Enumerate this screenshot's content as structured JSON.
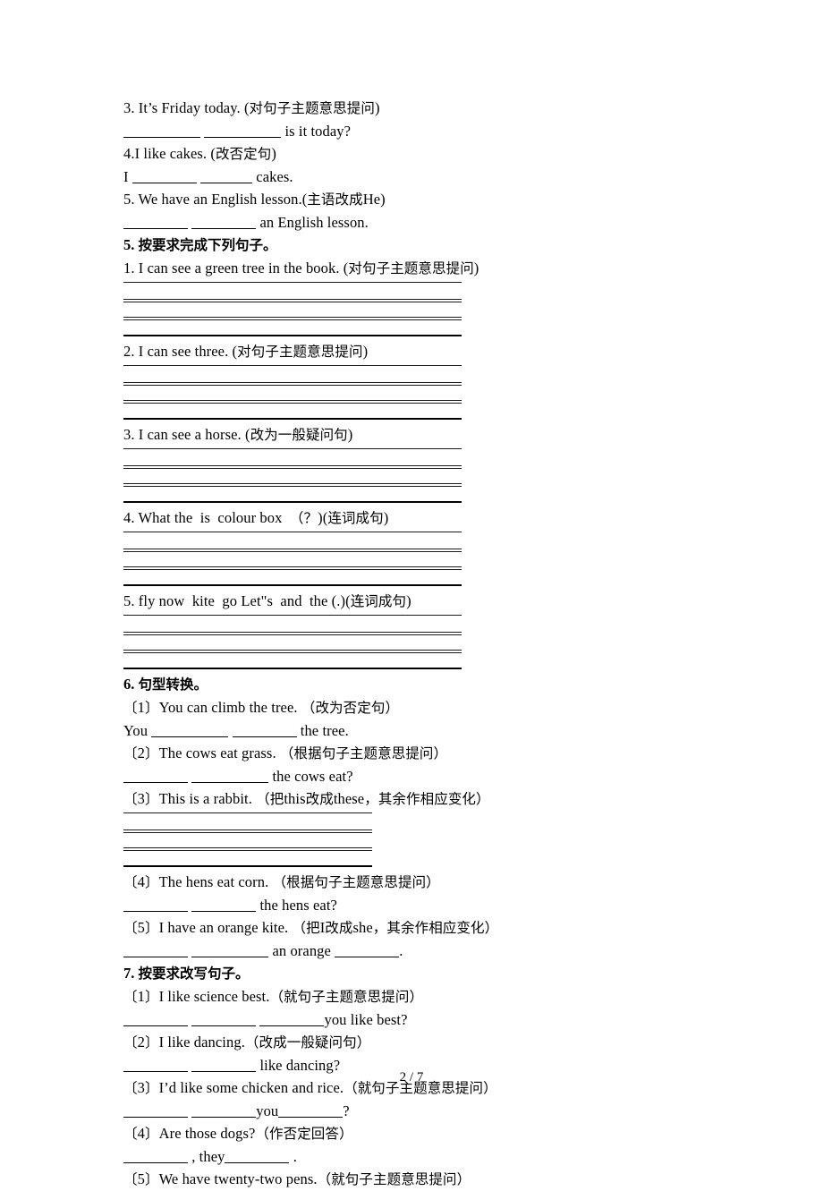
{
  "page": {
    "footer": "2 / 7"
  },
  "blocks": [
    {
      "kind": "text",
      "name": "question-3-prompt",
      "text": "3. It’s Friday today. (对句子主题意思提问)"
    },
    {
      "kind": "answer-line",
      "name": "question-3-answer",
      "pre": "",
      "blanks": [
        "b-lg",
        "b-lg"
      ],
      "post": " is it today?"
    },
    {
      "kind": "text",
      "name": "question-4-prompt",
      "text": "4.I like cakes. (改否定句)"
    },
    {
      "kind": "answer-line",
      "name": "question-4-answer",
      "pre": "I ",
      "blanks": [
        "b-md",
        "b-sm"
      ],
      "post": " cakes."
    },
    {
      "kind": "text",
      "name": "question-5-prompt",
      "text": "5. We have an English lesson.(主语改成He)"
    },
    {
      "kind": "answer-line",
      "name": "question-5-answer",
      "pre": "",
      "blanks": [
        "b-md",
        "b-md"
      ],
      "post": " an English lesson."
    },
    {
      "kind": "heading",
      "name": "section-5-heading",
      "text": "5. 按要求完成下列句子。"
    },
    {
      "kind": "text",
      "name": "section5-item-1",
      "text": "1. I can see a green tree in the book. (对句子主题意思提问)"
    },
    {
      "kind": "rules",
      "name": "section5-item-1-rules",
      "width": "w-long"
    },
    {
      "kind": "text",
      "name": "section5-item-2",
      "text": "2. I can see three. (对句子主题意思提问)"
    },
    {
      "kind": "rules",
      "name": "section5-item-2-rules",
      "width": "w-long"
    },
    {
      "kind": "text",
      "name": "section5-item-3",
      "text": "3. I can see a horse. (改为一般疑问句)"
    },
    {
      "kind": "rules",
      "name": "section5-item-3-rules",
      "width": "w-long"
    },
    {
      "kind": "text",
      "name": "section5-item-4",
      "text": "4. What the  is  colour box  （？)(连词成句)"
    },
    {
      "kind": "rules",
      "name": "section5-item-4-rules",
      "width": "w-long"
    },
    {
      "kind": "text",
      "name": "section5-item-5",
      "text": "5. fly now  kite  go Let\"s  and  the (.)(连词成句)"
    },
    {
      "kind": "rules",
      "name": "section5-item-5-rules",
      "width": "w-long"
    },
    {
      "kind": "heading",
      "name": "section-6-heading",
      "text": "6. 句型转换。"
    },
    {
      "kind": "text",
      "name": "section6-item-1",
      "text": "〔1〕You can climb the tree. （改为否定句）"
    },
    {
      "kind": "answer-line",
      "name": "section6-item-1-answer",
      "pre": "You ",
      "blanks": [
        "b-lg",
        "b-md"
      ],
      "post": " the tree."
    },
    {
      "kind": "text",
      "name": "section6-item-2",
      "text": "〔2〕The cows eat grass. （根据句子主题意思提问）"
    },
    {
      "kind": "answer-line",
      "name": "section6-item-2-answer",
      "pre": "",
      "blanks": [
        "b-md",
        "b-lg"
      ],
      "post": " the cows eat?"
    },
    {
      "kind": "text",
      "name": "section6-item-3",
      "text": "〔3〕This is a rabbit. （把this改成these，其余作相应变化）"
    },
    {
      "kind": "rules",
      "name": "section6-item-3-rules",
      "width": "w-short"
    },
    {
      "kind": "text",
      "name": "section6-item-4",
      "text": "〔4〕The hens eat corn. （根据句子主题意思提问）"
    },
    {
      "kind": "answer-line",
      "name": "section6-item-4-answer",
      "pre": "",
      "blanks": [
        "b-md",
        "b-md"
      ],
      "post": " the hens eat?"
    },
    {
      "kind": "text",
      "name": "section6-item-5",
      "text": "〔5〕I have an orange kite. （把I改成she，其余作相应变化）"
    },
    {
      "kind": "answer-line",
      "name": "section6-item-5-answer",
      "pre": "",
      "blanks": [
        "b-md",
        "b-lg"
      ],
      "post": " an orange ",
      "tail_blanks": [
        "b-md"
      ],
      "tail": "."
    },
    {
      "kind": "heading",
      "name": "section-7-heading",
      "text": "7. 按要求改写句子。"
    },
    {
      "kind": "text",
      "name": "section7-item-1",
      "text": "〔1〕I like science best.（就句子主题意思提问）"
    },
    {
      "kind": "answer-line",
      "name": "section7-item-1-answer",
      "pre": "",
      "blanks": [
        "b-md",
        "b-md",
        "b-md"
      ],
      "post": "you like best?"
    },
    {
      "kind": "text",
      "name": "section7-item-2",
      "text": "〔2〕I like dancing.（改成一般疑问句）"
    },
    {
      "kind": "answer-line",
      "name": "section7-item-2-answer",
      "pre": "",
      "blanks": [
        "b-md",
        "b-md"
      ],
      "post": " like dancing?"
    },
    {
      "kind": "text",
      "name": "section7-item-3",
      "text": "〔3〕I’d like some chicken and rice.（就句子主题意思提问）"
    },
    {
      "kind": "answer-line",
      "name": "section7-item-3-answer",
      "pre": "",
      "blanks": [
        "b-md",
        "b-md"
      ],
      "post": "you",
      "tail_blanks": [
        "b-md"
      ],
      "tail": "?"
    },
    {
      "kind": "text",
      "name": "section7-item-4",
      "text": "〔4〕Are those dogs?（作否定回答）"
    },
    {
      "kind": "answer-line",
      "name": "section7-item-4-answer",
      "pre": "",
      "blanks": [
        "b-md"
      ],
      "post": " , they",
      "tail_blanks": [
        "b-md"
      ],
      "tail": " ."
    },
    {
      "kind": "text",
      "name": "section7-item-5",
      "text": "〔5〕We have twenty-two pens.（就句子主题意思提问）"
    }
  ]
}
